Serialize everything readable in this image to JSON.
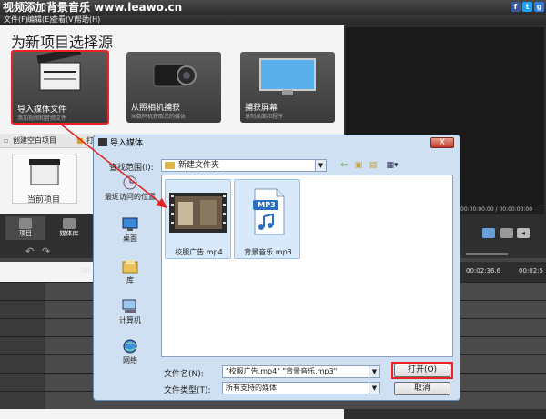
{
  "app": {
    "title": "视频添加背景音乐 www.leawo.cn",
    "menu": [
      "文件(F)",
      "编辑(E)",
      "查看(V)",
      "帮助(H)"
    ]
  },
  "source_panel": {
    "heading": "为新项目选择源",
    "cards": [
      {
        "label": "导入媒体文件",
        "sub": "添加视频和音频文件"
      },
      {
        "label": "从照相机捕获",
        "sub": "从数码机获取您的媒体"
      },
      {
        "label": "捕获屏幕",
        "sub": "录制桌面和程序"
      }
    ]
  },
  "project": {
    "toolbar_items": [
      "创建空白项目",
      "打"
    ],
    "current_label": "当前项目"
  },
  "tabs": [
    "项目",
    "媒体库"
  ],
  "timeline": {
    "time_left": "00:0",
    "time_mid": "00:02:36.6",
    "time_right": "00:02:5"
  },
  "dialog": {
    "title": "导入媒体",
    "close": "X",
    "lookin_label": "查找范围(I):",
    "lookin_value": "新建文件夹",
    "places": [
      "最近访问的位置",
      "桌面",
      "库",
      "计算机",
      "网络"
    ],
    "files": [
      {
        "name": "校服广告.mp4",
        "icon": "video-thumbnail"
      },
      {
        "name": "背景音乐.mp3",
        "icon": "mp3-file-icon",
        "badge": "MP3"
      }
    ],
    "filename_label": "文件名(N):",
    "filename_value": "\"校服广告.mp4\" \"背景音乐.mp3\"",
    "filetype_label": "文件类型(T):",
    "filetype_value": "所有支持的媒体",
    "open_button": "打开(O)",
    "cancel_button": "取消"
  },
  "colors": {
    "highlight": "#e22222",
    "dialog_bg": "#cfe0f2",
    "dark_bg": "#2e2e2e"
  }
}
